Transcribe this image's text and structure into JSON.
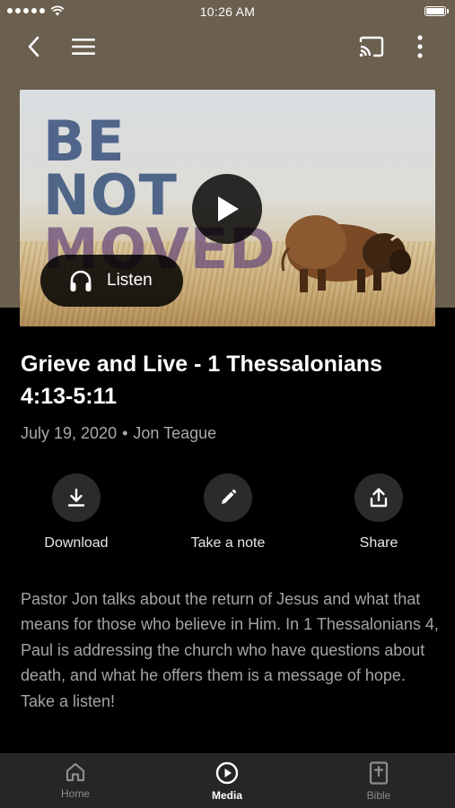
{
  "status_bar": {
    "time": "10:26 AM"
  },
  "nav": {
    "icons": [
      "back-icon",
      "menu-icon",
      "cast-icon",
      "more-vertical-icon"
    ]
  },
  "hero": {
    "artwork_words": [
      "BE",
      "NOT",
      "MOVED"
    ],
    "listen_label": "Listen"
  },
  "sermon": {
    "title": "Grieve and Live - 1 Thessalonians 4:13-5:11",
    "date": "July 19, 2020",
    "separator": "•",
    "speaker": "Jon Teague",
    "description": "Pastor Jon talks about the return of Jesus and what that means for those who believe in Him. In 1 Thessalonians 4, Paul is addressing the church who have questions about death, and what he offers them is a message of hope. Take a listen!"
  },
  "actions": [
    {
      "label": "Download",
      "icon": "download-icon"
    },
    {
      "label": "Take a note",
      "icon": "pencil-icon"
    },
    {
      "label": "Share",
      "icon": "share-icon"
    }
  ],
  "tabs": [
    {
      "label": "Home",
      "icon": "home-icon",
      "active": false
    },
    {
      "label": "Media",
      "icon": "play-circle-icon",
      "active": true
    },
    {
      "label": "Bible",
      "icon": "bible-icon",
      "active": false
    }
  ],
  "colors": {
    "header_background": "#6b5f4f",
    "page_background": "#000000",
    "tab_bar_background": "#262626",
    "action_circle": "#2b2b2b"
  }
}
